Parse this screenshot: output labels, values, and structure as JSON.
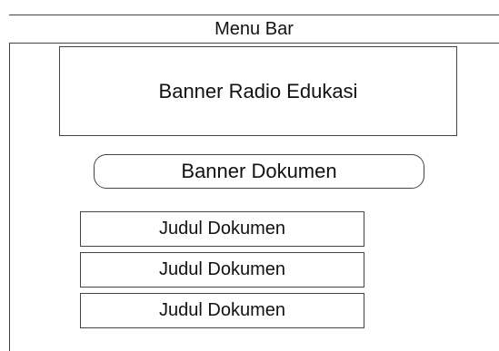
{
  "menu_bar": {
    "label": "Menu Bar"
  },
  "banner_radio": {
    "label": "Banner Radio Edukasi"
  },
  "banner_dokumen": {
    "label": "Banner Dokumen"
  },
  "documents": [
    {
      "label": "Judul Dokumen"
    },
    {
      "label": "Judul Dokumen"
    },
    {
      "label": "Judul Dokumen"
    }
  ]
}
